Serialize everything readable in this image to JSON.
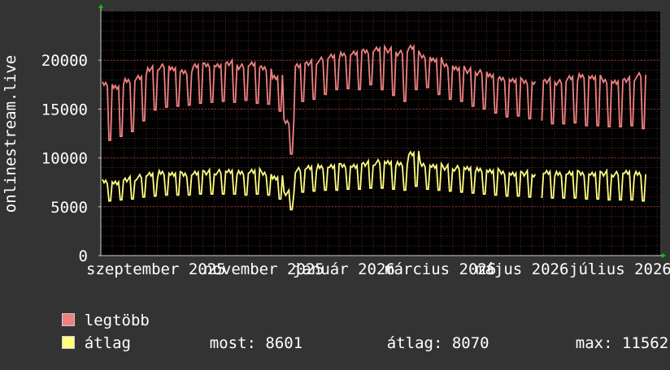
{
  "chart_data": {
    "type": "line",
    "ylabel": "onlinestream.live",
    "ylim": [
      0,
      25000
    ],
    "yticks": [
      0,
      5000,
      10000,
      15000,
      20000
    ],
    "ytick_labels": [
      "0",
      "5000",
      "10000",
      "15000",
      "20000"
    ],
    "xtick_labels": [
      "szeptember 2025",
      "november 2025",
      "január 2026",
      "március 2026",
      "május 2026",
      "július 2026"
    ],
    "xlim": [
      "2025-08-25",
      "2026-08-05"
    ],
    "grid": true,
    "series": [
      {
        "name": "legtöbb",
        "color": "#f08080",
        "weekday_level": [
          17800,
          17500,
          18200,
          18600,
          19400,
          19600,
          19300,
          19000,
          19700,
          19800,
          19800,
          20000,
          19600,
          19800,
          19400,
          18500,
          14000,
          19800,
          20000,
          20300,
          20600,
          20800,
          21000,
          21200,
          21500,
          21300,
          21000,
          21500,
          20600,
          20300,
          19800,
          19500,
          19200,
          19000,
          18600,
          18300,
          18200,
          18100,
          18000,
          18200,
          18000,
          18400,
          18600,
          18500,
          18200,
          18100,
          18300,
          18700
        ],
        "weekend_level": [
          11800,
          12200,
          12700,
          13800,
          14900,
          15200,
          15300,
          15400,
          15600,
          15700,
          15800,
          15700,
          15900,
          15600,
          15500,
          14800,
          10400,
          15800,
          16000,
          16500,
          17000,
          17100,
          17000,
          17500,
          17000,
          16400,
          15800,
          17000,
          17200,
          16500,
          16000,
          15800,
          15300,
          15000,
          14600,
          14200,
          14300,
          14000,
          13800,
          13500,
          13500,
          13600,
          13300,
          13300,
          13200,
          13200,
          13300,
          13000
        ]
      },
      {
        "name": "átlag",
        "color": "#ffff80",
        "weekday_level": [
          7900,
          7800,
          8100,
          8300,
          8500,
          8700,
          8600,
          8600,
          8800,
          8800,
          8800,
          8800,
          8700,
          8900,
          8700,
          8300,
          6700,
          9000,
          9200,
          9300,
          9400,
          9500,
          9500,
          9700,
          9800,
          9700,
          9600,
          10700,
          9600,
          9500,
          9300,
          9200,
          9100,
          9000,
          8900,
          8800,
          8700,
          8700,
          8600,
          8700,
          8600,
          8700,
          8700,
          8700,
          8700,
          8600,
          8700,
          8601
        ],
        "weekend_level": [
          5600,
          5700,
          5800,
          6000,
          6100,
          6200,
          6200,
          6200,
          6300,
          6300,
          6300,
          6300,
          6200,
          6300,
          6200,
          5800,
          4700,
          6500,
          6600,
          6700,
          6700,
          6800,
          6800,
          6900,
          6900,
          6800,
          6700,
          7100,
          6800,
          6700,
          6600,
          6500,
          6400,
          6300,
          6200,
          6100,
          6100,
          6000,
          5900,
          5900,
          5900,
          5900,
          5800,
          5800,
          5700,
          5700,
          5700,
          5600
        ]
      }
    ],
    "gap_weeks": [
      38
    ]
  },
  "legend": {
    "max_label": "legtöbb",
    "avg_label": "átlag",
    "stats": {
      "most_label": "most:",
      "most_value": "8601",
      "atlag_label": "átlag:",
      "atlag_value": "8070",
      "max_label": "max:",
      "max_value": "11562"
    }
  },
  "colors": {
    "background": "#333333",
    "plot_background": "#000000",
    "grid": "#5a2a2a",
    "axis_arrow": "#00cc00"
  }
}
